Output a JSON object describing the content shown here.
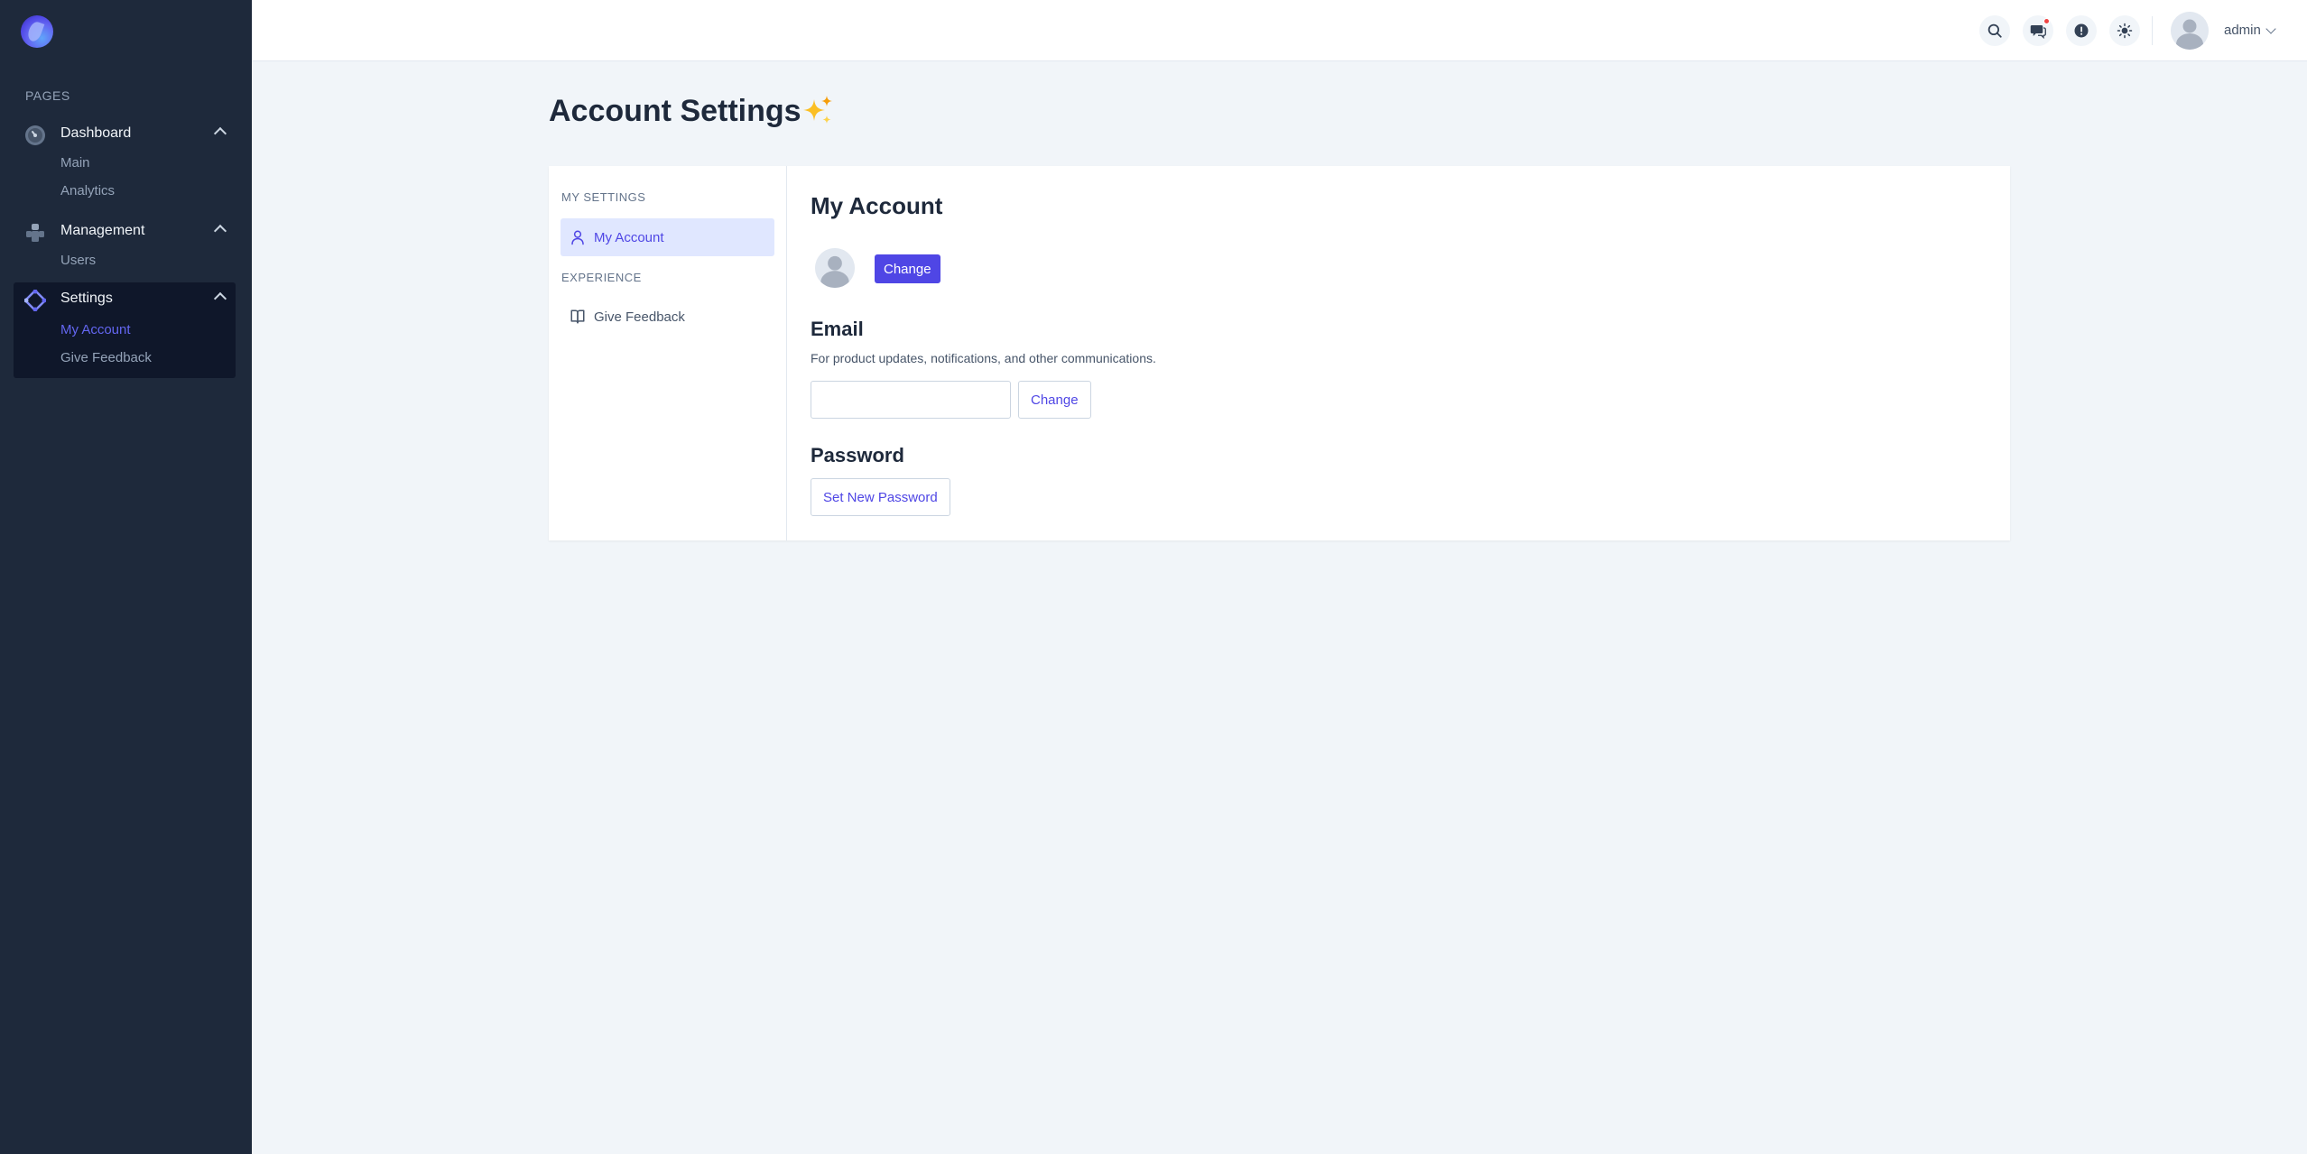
{
  "sidebar": {
    "section_label": "PAGES",
    "groups": [
      {
        "title": "Dashboard",
        "icon": "dashboard-icon",
        "items": [
          "Main",
          "Analytics"
        ]
      },
      {
        "title": "Management",
        "icon": "management-icon",
        "items": [
          "Users"
        ]
      },
      {
        "title": "Settings",
        "icon": "settings-icon",
        "items": [
          "My Account",
          "Give Feedback"
        ],
        "current": "My Account"
      }
    ]
  },
  "topbar": {
    "icons": [
      "search-icon",
      "chat-icon",
      "alert-icon",
      "theme-toggle-icon"
    ],
    "notification_dot_color": "#ef4444",
    "user_name": "admin"
  },
  "page": {
    "title": "Account Settings",
    "title_emoji": "✨"
  },
  "settings_nav": {
    "sections": [
      {
        "label": "MY SETTINGS",
        "items": [
          {
            "label": "My Account",
            "icon": "user-icon",
            "active": true
          }
        ]
      },
      {
        "label": "EXPERIENCE",
        "items": [
          {
            "label": "Give Feedback",
            "icon": "book-icon",
            "active": false
          }
        ]
      }
    ]
  },
  "account": {
    "heading": "My Account",
    "avatar_change_label": "Change",
    "email": {
      "heading": "Email",
      "description": "For product updates, notifications, and other communications.",
      "value": "",
      "change_label": "Change"
    },
    "password": {
      "heading": "Password",
      "set_label": "Set New Password"
    }
  },
  "colors": {
    "sidebar_bg": "#1e293b",
    "accent": "#4f46e5",
    "page_bg": "#f1f5f9"
  }
}
